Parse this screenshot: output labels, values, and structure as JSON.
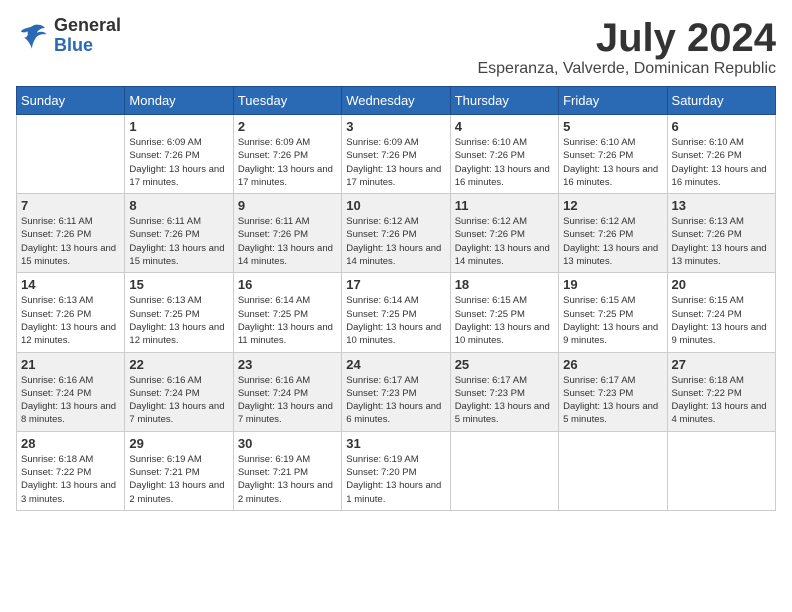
{
  "logo": {
    "general": "General",
    "blue": "Blue"
  },
  "title": "July 2024",
  "subtitle": "Esperanza, Valverde, Dominican Republic",
  "days_of_week": [
    "Sunday",
    "Monday",
    "Tuesday",
    "Wednesday",
    "Thursday",
    "Friday",
    "Saturday"
  ],
  "weeks": [
    [
      {
        "day": "",
        "sunrise": "",
        "sunset": "",
        "daylight": ""
      },
      {
        "day": "1",
        "sunrise": "Sunrise: 6:09 AM",
        "sunset": "Sunset: 7:26 PM",
        "daylight": "Daylight: 13 hours and 17 minutes."
      },
      {
        "day": "2",
        "sunrise": "Sunrise: 6:09 AM",
        "sunset": "Sunset: 7:26 PM",
        "daylight": "Daylight: 13 hours and 17 minutes."
      },
      {
        "day": "3",
        "sunrise": "Sunrise: 6:09 AM",
        "sunset": "Sunset: 7:26 PM",
        "daylight": "Daylight: 13 hours and 17 minutes."
      },
      {
        "day": "4",
        "sunrise": "Sunrise: 6:10 AM",
        "sunset": "Sunset: 7:26 PM",
        "daylight": "Daylight: 13 hours and 16 minutes."
      },
      {
        "day": "5",
        "sunrise": "Sunrise: 6:10 AM",
        "sunset": "Sunset: 7:26 PM",
        "daylight": "Daylight: 13 hours and 16 minutes."
      },
      {
        "day": "6",
        "sunrise": "Sunrise: 6:10 AM",
        "sunset": "Sunset: 7:26 PM",
        "daylight": "Daylight: 13 hours and 16 minutes."
      }
    ],
    [
      {
        "day": "7",
        "sunrise": "Sunrise: 6:11 AM",
        "sunset": "Sunset: 7:26 PM",
        "daylight": "Daylight: 13 hours and 15 minutes."
      },
      {
        "day": "8",
        "sunrise": "Sunrise: 6:11 AM",
        "sunset": "Sunset: 7:26 PM",
        "daylight": "Daylight: 13 hours and 15 minutes."
      },
      {
        "day": "9",
        "sunrise": "Sunrise: 6:11 AM",
        "sunset": "Sunset: 7:26 PM",
        "daylight": "Daylight: 13 hours and 14 minutes."
      },
      {
        "day": "10",
        "sunrise": "Sunrise: 6:12 AM",
        "sunset": "Sunset: 7:26 PM",
        "daylight": "Daylight: 13 hours and 14 minutes."
      },
      {
        "day": "11",
        "sunrise": "Sunrise: 6:12 AM",
        "sunset": "Sunset: 7:26 PM",
        "daylight": "Daylight: 13 hours and 14 minutes."
      },
      {
        "day": "12",
        "sunrise": "Sunrise: 6:12 AM",
        "sunset": "Sunset: 7:26 PM",
        "daylight": "Daylight: 13 hours and 13 minutes."
      },
      {
        "day": "13",
        "sunrise": "Sunrise: 6:13 AM",
        "sunset": "Sunset: 7:26 PM",
        "daylight": "Daylight: 13 hours and 13 minutes."
      }
    ],
    [
      {
        "day": "14",
        "sunrise": "Sunrise: 6:13 AM",
        "sunset": "Sunset: 7:26 PM",
        "daylight": "Daylight: 13 hours and 12 minutes."
      },
      {
        "day": "15",
        "sunrise": "Sunrise: 6:13 AM",
        "sunset": "Sunset: 7:25 PM",
        "daylight": "Daylight: 13 hours and 12 minutes."
      },
      {
        "day": "16",
        "sunrise": "Sunrise: 6:14 AM",
        "sunset": "Sunset: 7:25 PM",
        "daylight": "Daylight: 13 hours and 11 minutes."
      },
      {
        "day": "17",
        "sunrise": "Sunrise: 6:14 AM",
        "sunset": "Sunset: 7:25 PM",
        "daylight": "Daylight: 13 hours and 10 minutes."
      },
      {
        "day": "18",
        "sunrise": "Sunrise: 6:15 AM",
        "sunset": "Sunset: 7:25 PM",
        "daylight": "Daylight: 13 hours and 10 minutes."
      },
      {
        "day": "19",
        "sunrise": "Sunrise: 6:15 AM",
        "sunset": "Sunset: 7:25 PM",
        "daylight": "Daylight: 13 hours and 9 minutes."
      },
      {
        "day": "20",
        "sunrise": "Sunrise: 6:15 AM",
        "sunset": "Sunset: 7:24 PM",
        "daylight": "Daylight: 13 hours and 9 minutes."
      }
    ],
    [
      {
        "day": "21",
        "sunrise": "Sunrise: 6:16 AM",
        "sunset": "Sunset: 7:24 PM",
        "daylight": "Daylight: 13 hours and 8 minutes."
      },
      {
        "day": "22",
        "sunrise": "Sunrise: 6:16 AM",
        "sunset": "Sunset: 7:24 PM",
        "daylight": "Daylight: 13 hours and 7 minutes."
      },
      {
        "day": "23",
        "sunrise": "Sunrise: 6:16 AM",
        "sunset": "Sunset: 7:24 PM",
        "daylight": "Daylight: 13 hours and 7 minutes."
      },
      {
        "day": "24",
        "sunrise": "Sunrise: 6:17 AM",
        "sunset": "Sunset: 7:23 PM",
        "daylight": "Daylight: 13 hours and 6 minutes."
      },
      {
        "day": "25",
        "sunrise": "Sunrise: 6:17 AM",
        "sunset": "Sunset: 7:23 PM",
        "daylight": "Daylight: 13 hours and 5 minutes."
      },
      {
        "day": "26",
        "sunrise": "Sunrise: 6:17 AM",
        "sunset": "Sunset: 7:23 PM",
        "daylight": "Daylight: 13 hours and 5 minutes."
      },
      {
        "day": "27",
        "sunrise": "Sunrise: 6:18 AM",
        "sunset": "Sunset: 7:22 PM",
        "daylight": "Daylight: 13 hours and 4 minutes."
      }
    ],
    [
      {
        "day": "28",
        "sunrise": "Sunrise: 6:18 AM",
        "sunset": "Sunset: 7:22 PM",
        "daylight": "Daylight: 13 hours and 3 minutes."
      },
      {
        "day": "29",
        "sunrise": "Sunrise: 6:19 AM",
        "sunset": "Sunset: 7:21 PM",
        "daylight": "Daylight: 13 hours and 2 minutes."
      },
      {
        "day": "30",
        "sunrise": "Sunrise: 6:19 AM",
        "sunset": "Sunset: 7:21 PM",
        "daylight": "Daylight: 13 hours and 2 minutes."
      },
      {
        "day": "31",
        "sunrise": "Sunrise: 6:19 AM",
        "sunset": "Sunset: 7:20 PM",
        "daylight": "Daylight: 13 hours and 1 minute."
      },
      {
        "day": "",
        "sunrise": "",
        "sunset": "",
        "daylight": ""
      },
      {
        "day": "",
        "sunrise": "",
        "sunset": "",
        "daylight": ""
      },
      {
        "day": "",
        "sunrise": "",
        "sunset": "",
        "daylight": ""
      }
    ]
  ]
}
